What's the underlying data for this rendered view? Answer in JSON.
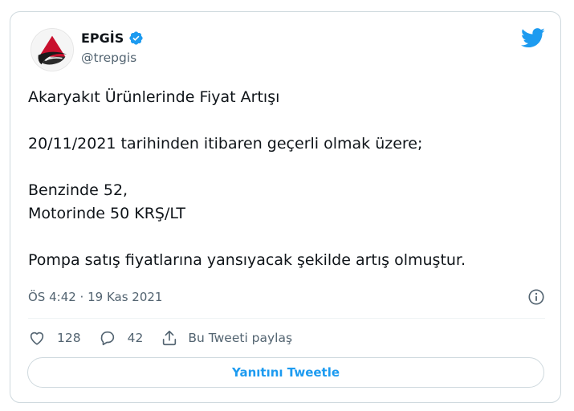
{
  "author": {
    "name": "EPGİS",
    "handle": "@trepgis",
    "verified": true,
    "avatar_icon": "epgis-logo-icon"
  },
  "tweet": {
    "text": "Akaryakıt Ürünlerinde Fiyat Artışı\n\n20/11/2021 tarihinden itibaren geçerli olmak üzere;\n\nBenzinde 52,\nMotorinde 50 KRŞ/LT\n\nPompa satış fiyatlarına yansıyacak şekilde artış olmuştur.",
    "timestamp": "ÖS 4:42 · 19 Kas 2021"
  },
  "actions": {
    "like_count": "128",
    "reply_count": "42",
    "share_label": "Bu Tweeti paylaş"
  },
  "reply_button_label": "Yanıtını Tweetle",
  "colors": {
    "brand_blue": "#1d9bf0",
    "muted_text": "#536471",
    "border": "#cfd9de",
    "logo_red": "#c8102e"
  }
}
